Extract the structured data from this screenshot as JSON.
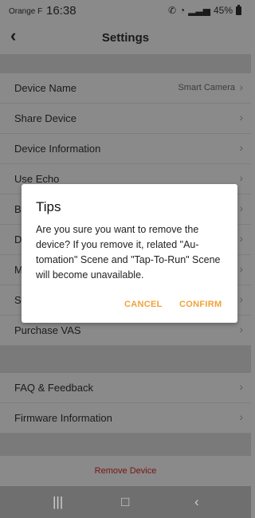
{
  "status_bar": {
    "carrier": "Orange F",
    "time": "16:38",
    "battery": "45%"
  },
  "header": {
    "title": "Settings"
  },
  "rows": [
    {
      "label": "Device Name",
      "value": "Smart Camera"
    },
    {
      "label": "Share Device"
    },
    {
      "label": "Device Information"
    },
    {
      "label": "Use Echo"
    },
    {
      "label": "B"
    },
    {
      "label": "D"
    },
    {
      "label": "M"
    },
    {
      "label": "S"
    },
    {
      "label": "Purchase VAS"
    },
    {
      "label": "FAQ & Feedback"
    },
    {
      "label": "Firmware Information"
    }
  ],
  "remove_label": "Remove Device",
  "dialog": {
    "title": "Tips",
    "message": "Are you sure you want to remove the device? If you remove it, related \"Au-tomation\" Scene and \"Tap-To-Run\" Scene will become unavailable.",
    "cancel": "CANCEL",
    "confirm": "CONFIRM"
  },
  "colors": {
    "accent": "#f0a238",
    "danger": "#7a1313"
  }
}
